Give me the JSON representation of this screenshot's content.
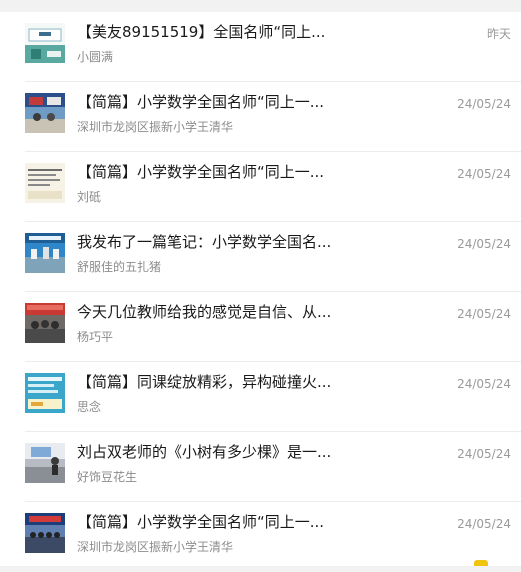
{
  "feed": {
    "items": [
      {
        "title": "【美友89151519】全国名师“同上...",
        "author": "小圆满",
        "date": "昨天",
        "thumb_icon": "cover-thumbnail-icon"
      },
      {
        "title": "【简篇】小学数学全国名师“同上一...",
        "author": "深圳市龙岗区振新小学王清华",
        "date": "24/05/24",
        "thumb_icon": "cover-thumbnail-icon"
      },
      {
        "title": "【简篇】小学数学全国名师“同上一...",
        "author": "刘砥",
        "date": "24/05/24",
        "thumb_icon": "cover-thumbnail-icon"
      },
      {
        "title": "我发布了一篇笔记：小学数学全国名...",
        "author": "舒服佳的五扎猪",
        "date": "24/05/24",
        "thumb_icon": "cover-thumbnail-icon"
      },
      {
        "title": "今天几位教师给我的感觉是自信、从...",
        "author": "杨巧平",
        "date": "24/05/24",
        "thumb_icon": "cover-thumbnail-icon"
      },
      {
        "title": "【简篇】同课绽放精彩，异构碰撞火...",
        "author": "思念",
        "date": "24/05/24",
        "thumb_icon": "cover-thumbnail-icon"
      },
      {
        "title": "刘占双老师的《小树有多少棵》是一...",
        "author": "好饰豆花生",
        "date": "24/05/24",
        "thumb_icon": "cover-thumbnail-icon"
      },
      {
        "title": "【简篇】小学数学全国名师“同上一...",
        "author": "深圳市龙岗区振新小学王清华",
        "date": "24/05/24",
        "thumb_icon": "cover-thumbnail-icon"
      }
    ]
  },
  "colors": {
    "title": "#191919",
    "author": "#8c8c8c",
    "date": "#9a9a9a",
    "divider": "#ececec",
    "background": "#f2f2f2"
  }
}
